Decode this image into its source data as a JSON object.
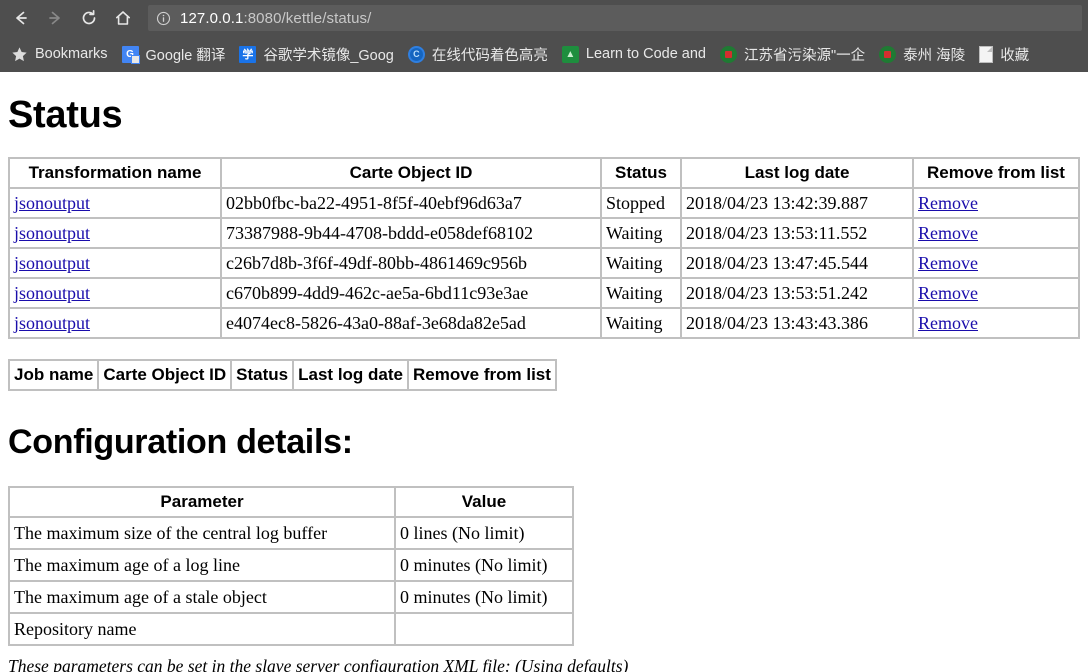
{
  "browser": {
    "nav": {
      "back_icon": "arrow-left-icon",
      "forward_icon": "arrow-right-icon",
      "reload_icon": "reload-icon",
      "home_icon": "home-icon"
    },
    "omnibox": {
      "info_icon": "info-circle-icon",
      "url_host": "127.0.0.1",
      "url_rest": ":8080/kettle/status/",
      "url_full": "127.0.0.1:8080/kettle/status/"
    },
    "bookmarks": [
      {
        "label": "Bookmarks",
        "icon": "star-icon"
      },
      {
        "label": "Google 翻译",
        "icon": "google-translate-icon"
      },
      {
        "label": "谷歌学术镜像_Goog",
        "icon": "google-scholar-icon"
      },
      {
        "label": "在线代码着色高亮",
        "icon": "code-highlight-icon"
      },
      {
        "label": "Learn to Code and",
        "icon": "learn-to-code-icon"
      },
      {
        "label": "江苏省污染源\"一企",
        "icon": "gov-emblem-icon"
      },
      {
        "label": "泰州 海陵",
        "icon": "gov-emblem-icon"
      },
      {
        "label": "收藏",
        "icon": "document-icon"
      }
    ]
  },
  "page": {
    "status_title": "Status",
    "config_title": "Configuration details:",
    "config_note": "These parameters can be set in the slave server configuration XML file: (Using defaults)",
    "transformations": {
      "headers": [
        "Transformation name",
        "Carte Object ID",
        "Status",
        "Last log date",
        "Remove from list"
      ],
      "rows": [
        {
          "name": "jsonoutput",
          "object_id": "02bb0fbc-ba22-4951-8f5f-40ebf96d63a7",
          "status": "Stopped",
          "last_log_date": "2018/04/23 13:42:39.887",
          "remove": "Remove"
        },
        {
          "name": "jsonoutput",
          "object_id": "73387988-9b44-4708-bddd-e058def68102",
          "status": "Waiting",
          "last_log_date": "2018/04/23 13:53:11.552",
          "remove": "Remove"
        },
        {
          "name": "jsonoutput",
          "object_id": "c26b7d8b-3f6f-49df-80bb-4861469c956b",
          "status": "Waiting",
          "last_log_date": "2018/04/23 13:47:45.544",
          "remove": "Remove"
        },
        {
          "name": "jsonoutput",
          "object_id": "c670b899-4dd9-462c-ae5a-6bd11c93e3ae",
          "status": "Waiting",
          "last_log_date": "2018/04/23 13:53:51.242",
          "remove": "Remove"
        },
        {
          "name": "jsonoutput",
          "object_id": "e4074ec8-5826-43a0-88af-3e68da82e5ad",
          "status": "Waiting",
          "last_log_date": "2018/04/23 13:43:43.386",
          "remove": "Remove"
        }
      ]
    },
    "jobs": {
      "headers": [
        "Job name",
        "Carte Object ID",
        "Status",
        "Last log date",
        "Remove from list"
      ],
      "rows": []
    },
    "configuration": {
      "headers": [
        "Parameter",
        "Value"
      ],
      "rows": [
        {
          "parameter": "The maximum size of the central log buffer",
          "value": "0 lines (No limit)"
        },
        {
          "parameter": "The maximum age of a log line",
          "value": "0 minutes (No limit)"
        },
        {
          "parameter": "The maximum age of a stale object",
          "value": "0 minutes (No limit)"
        },
        {
          "parameter": "Repository name",
          "value": ""
        }
      ]
    }
  },
  "colors": {
    "chrome_bg": "#4e4e4e",
    "omnibox_bg": "#5c5c5c",
    "link": "#1a0dab",
    "table_border": "#c0c0c0"
  }
}
